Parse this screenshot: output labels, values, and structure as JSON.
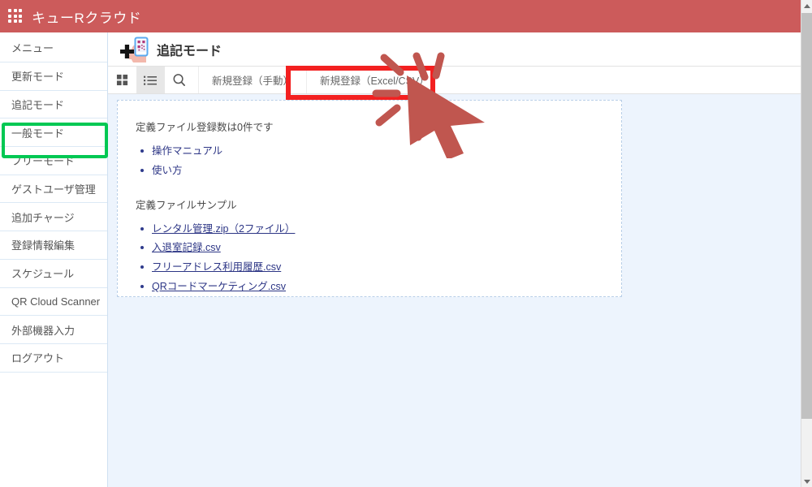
{
  "header": {
    "brand": "キューRクラウド",
    "app_grid_icon": "grid-apps-icon",
    "bg_color": "#cc5b5b"
  },
  "sidebar": {
    "items": [
      {
        "label": "メニュー",
        "active": false
      },
      {
        "label": "更新モード",
        "active": false
      },
      {
        "label": "追記モード",
        "active": true
      },
      {
        "label": "一般モード",
        "active": false
      },
      {
        "label": "フリーモード",
        "active": false
      },
      {
        "label": "ゲストユーザ管理",
        "active": false
      },
      {
        "label": "追加チャージ",
        "active": false
      },
      {
        "label": "登録情報編集",
        "active": false
      },
      {
        "label": "スケジュール",
        "active": false
      },
      {
        "label": "QR Cloud Scanner",
        "active": false
      },
      {
        "label": "外部機器入力",
        "active": false
      },
      {
        "label": "ログアウト",
        "active": false
      }
    ],
    "highlight_color": "#00c853"
  },
  "page": {
    "title": "追記モード",
    "icon": "add-qr-phone-icon"
  },
  "toolbar": {
    "icons": [
      {
        "name": "grid-view-icon",
        "active": false
      },
      {
        "name": "list-view-icon",
        "active": true
      },
      {
        "name": "search-icon",
        "active": false
      }
    ],
    "buttons": [
      {
        "label": "新規登録（手動）",
        "highlighted": false
      },
      {
        "label": "新規登録（Excel/CSV）",
        "highlighted": true
      }
    ]
  },
  "content": {
    "status_text": "定義ファイル登録数は0件です",
    "help_links": [
      "操作マニュアル",
      "使い方"
    ],
    "sample_heading": "定義ファイルサンプル",
    "sample_links": [
      "レンタル管理.zip（2ファイル）",
      "入退室記録.csv",
      "フリーアドレス利用履歴.csv",
      "QRコードマーケティング.csv"
    ],
    "link_color": "#2c3585",
    "card_bg": "#ffffff",
    "area_bg": "#edf4fd"
  },
  "annotation": {
    "highlight_border_color": "#f32020",
    "cursor_color": "#c0564f",
    "target": "新規登録（Excel/CSV）"
  }
}
